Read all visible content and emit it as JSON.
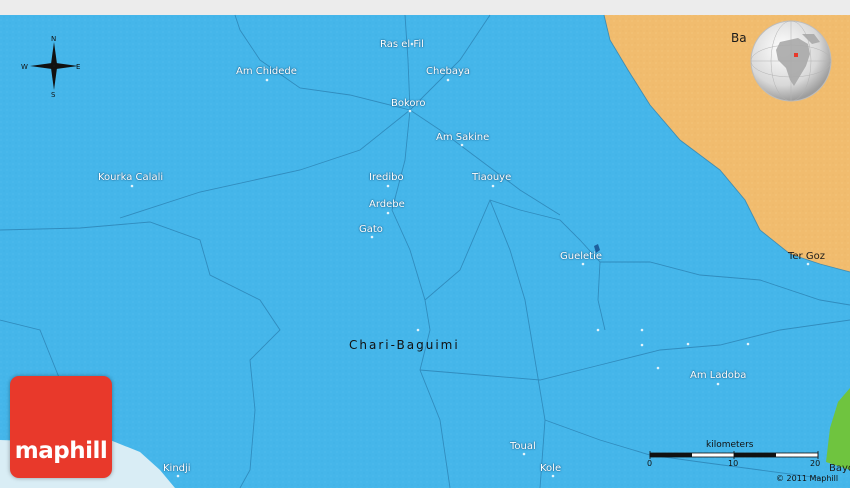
{
  "map": {
    "region_label": "Chari-Baguimi",
    "places": [
      {
        "name": "Ras el Fil"
      },
      {
        "name": "Am Chidede"
      },
      {
        "name": "Chebaya"
      },
      {
        "name": "Bokoro"
      },
      {
        "name": "Am Sakine"
      },
      {
        "name": "Kourka Calali"
      },
      {
        "name": "Iredibo"
      },
      {
        "name": "Tiaouye"
      },
      {
        "name": "Ardebe"
      },
      {
        "name": "Gato"
      },
      {
        "name": "Gueletie"
      },
      {
        "name": "Ter Goz"
      },
      {
        "name": "Am Ladoba"
      },
      {
        "name": "Toual"
      },
      {
        "name": "Kole"
      },
      {
        "name": "Kindji"
      },
      {
        "name": "Bayo"
      },
      {
        "name": "Ba"
      }
    ],
    "colors": {
      "water_blue": "#45b6ea",
      "neighbor_region": "#f1bc6e",
      "green_region": "#6fc43f",
      "lightblue_region": "#d9edf5"
    }
  },
  "compass": {
    "n": "N",
    "s": "S",
    "e": "E",
    "w": "W"
  },
  "logo": {
    "text": "maphill"
  },
  "scale": {
    "title": "kilometers",
    "ticks": [
      "0",
      "10",
      "20"
    ]
  },
  "copyright": "© 2011 Maphill",
  "globe": {
    "icon": "globe-locator-icon",
    "marker_color": "#e8392b"
  }
}
